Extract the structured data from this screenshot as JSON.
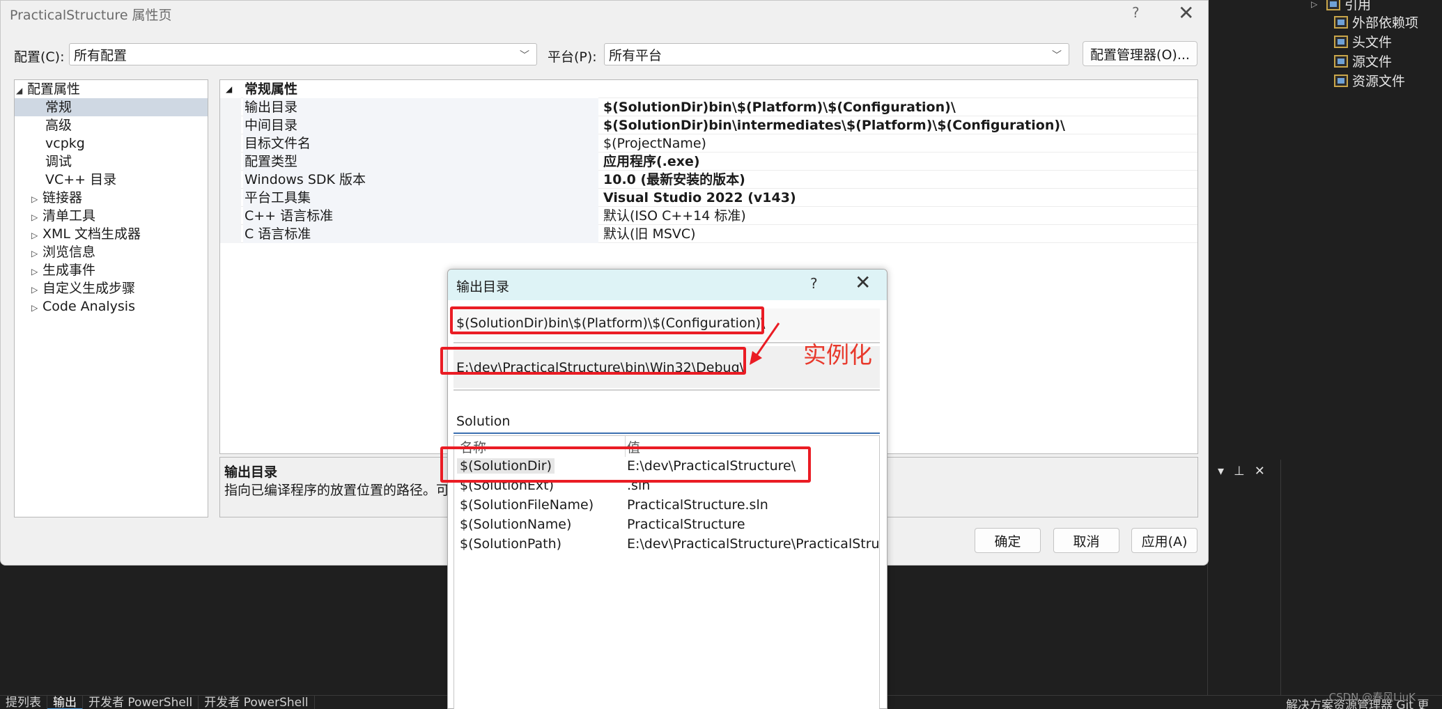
{
  "background": {
    "solution_tree": [
      {
        "label": "引用"
      },
      {
        "label": "外部依赖项"
      },
      {
        "label": "头文件"
      },
      {
        "label": "源文件"
      },
      {
        "label": "资源文件"
      }
    ],
    "bottom_tabs": [
      "提列表",
      "输出",
      "开发者 PowerShell",
      "开发者 PowerShell"
    ],
    "right_bottom_tabs": "解决方案资源管理器    Git 更",
    "watermark": "CSDN @春风LiuK"
  },
  "dialog": {
    "title": "PracticalStructure 属性页",
    "help": "?",
    "close": "✕",
    "config_label": "配置(C):",
    "config_value": "所有配置",
    "platform_label": "平台(P):",
    "platform_value": "所有平台",
    "config_manager": "配置管理器(O)...",
    "tree": [
      {
        "label": "配置属性",
        "expander": "◢"
      },
      {
        "label": "常规"
      },
      {
        "label": "高级"
      },
      {
        "label": "vcpkg"
      },
      {
        "label": "调试"
      },
      {
        "label": "VC++ 目录"
      },
      {
        "label": "链接器",
        "expander": "▷"
      },
      {
        "label": "清单工具",
        "expander": "▷"
      },
      {
        "label": "XML 文档生成器",
        "expander": "▷"
      },
      {
        "label": "浏览信息",
        "expander": "▷"
      },
      {
        "label": "生成事件",
        "expander": "▷"
      },
      {
        "label": "自定义生成步骤",
        "expander": "▷"
      },
      {
        "label": "Code Analysis",
        "expander": "▷"
      }
    ],
    "grid_header": {
      "label": "常规属性",
      "expander": "◢"
    },
    "grid_rows": [
      {
        "key": "输出目录",
        "value": "$(SolutionDir)bin\\$(Platform)\\$(Configuration)\\"
      },
      {
        "key": "中间目录",
        "value": "$(SolutionDir)bin\\intermediates\\$(Platform)\\$(Configuration)\\"
      },
      {
        "key": "目标文件名",
        "value": "$(ProjectName)"
      },
      {
        "key": "配置类型",
        "value": "应用程序(.exe)"
      },
      {
        "key": "Windows SDK 版本",
        "value": "10.0 (最新安装的版本)"
      },
      {
        "key": "平台工具集",
        "value": "Visual Studio 2022 (v143)"
      },
      {
        "key": "C++ 语言标准",
        "value": "默认(ISO C++14 标准)"
      },
      {
        "key": "C 语言标准",
        "value": "默认(旧 MSVC)"
      }
    ],
    "description_title": "输出目录",
    "description_text": "指向已编译程序的放置位置的路径。可以",
    "ok": "确定",
    "cancel": "取消",
    "apply": "应用(A)"
  },
  "popup": {
    "title": "输出目录",
    "help": "?",
    "close": "✕",
    "macro_value": "$(SolutionDir)bin\\$(Platform)\\$(Configuration)\\",
    "evaluated_value": "E:\\dev\\PracticalStructure\\bin\\Win32\\Debug\\",
    "filter_value": "Solution",
    "col_name": "名称",
    "col_value": "值",
    "macros": [
      {
        "name": "$(SolutionDir)",
        "value": "E:\\dev\\PracticalStructure\\"
      },
      {
        "name": "$(SolutionExt)",
        "value": ".sln"
      },
      {
        "name": "$(SolutionFileName)",
        "value": "PracticalStructure.sln"
      },
      {
        "name": "$(SolutionName)",
        "value": "PracticalStructure"
      },
      {
        "name": "$(SolutionPath)",
        "value": "E:\\dev\\PracticalStructure\\PracticalStructure.sln"
      }
    ]
  },
  "annotation": {
    "label": "实例化",
    "color": "#ea1c24"
  }
}
